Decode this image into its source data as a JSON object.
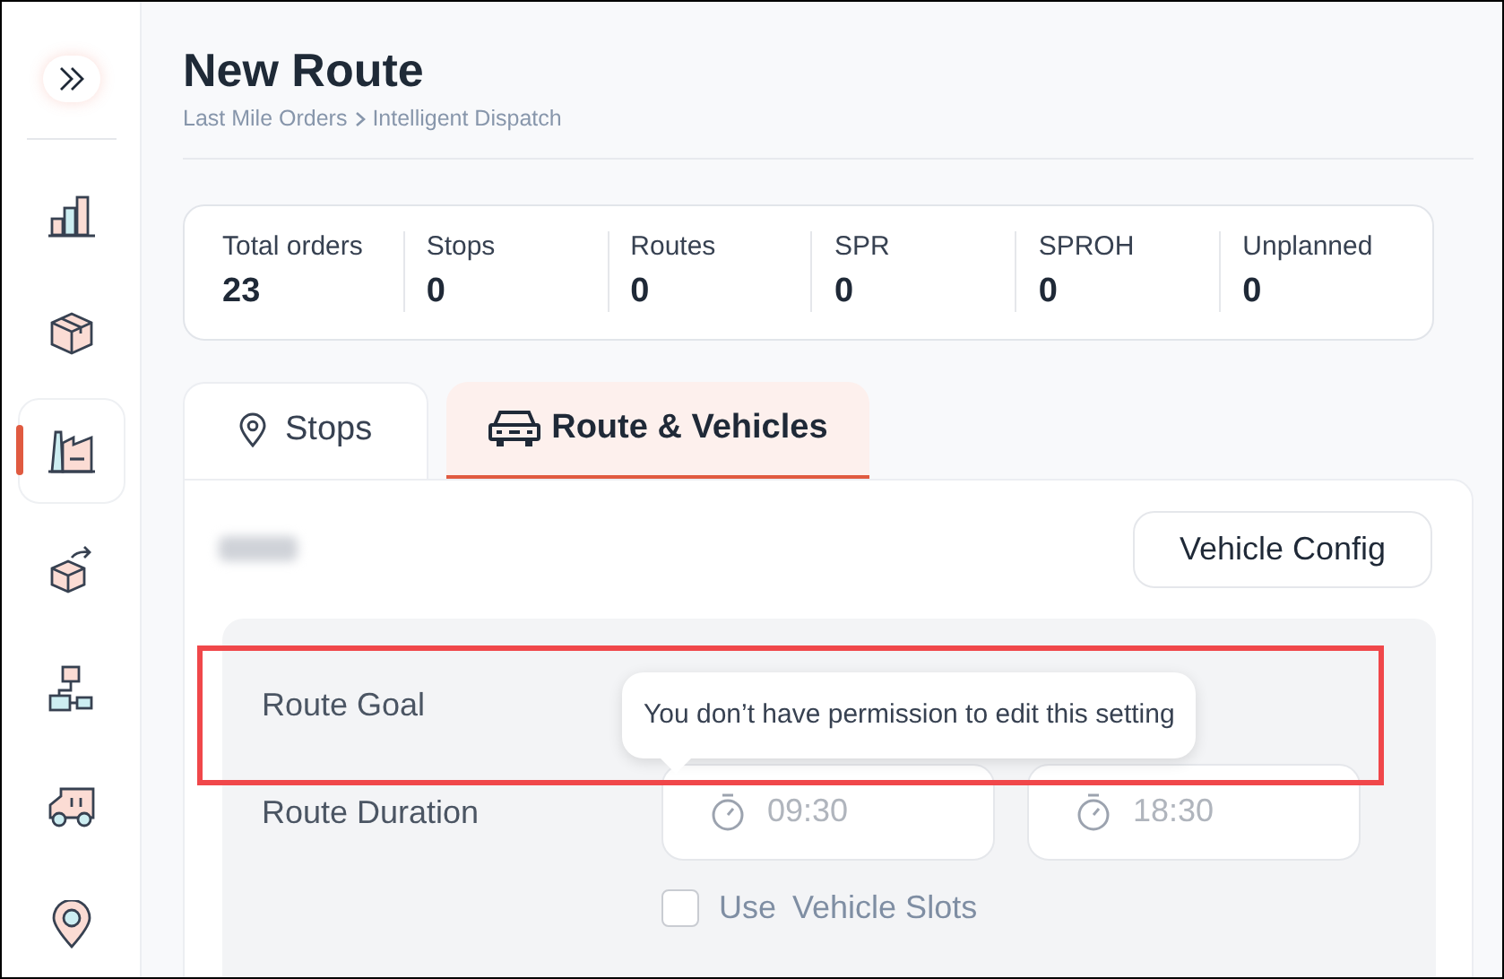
{
  "sidebar": {
    "items": [
      {
        "kind": "chart",
        "selected": false
      },
      {
        "kind": "box",
        "selected": false
      },
      {
        "kind": "dispatch",
        "selected": true
      },
      {
        "kind": "transfer",
        "selected": false
      },
      {
        "kind": "hierarchy",
        "selected": false
      },
      {
        "kind": "truck",
        "selected": false
      },
      {
        "kind": "pin",
        "selected": false
      }
    ]
  },
  "page": {
    "title": "New Route",
    "breadcrumb": [
      "Last Mile Orders",
      "Intelligent Dispatch"
    ]
  },
  "stats": [
    {
      "label": "Total orders",
      "value": "23"
    },
    {
      "label": "Stops",
      "value": "0"
    },
    {
      "label": "Routes",
      "value": "0"
    },
    {
      "label": "SPR",
      "value": "0"
    },
    {
      "label": "SPROH",
      "value": "0"
    },
    {
      "label": "Unplanned",
      "value": "0"
    }
  ],
  "tabs": [
    {
      "label": "Stops",
      "kind": "pin",
      "selected": false
    },
    {
      "label": "Route & Vehicles",
      "kind": "car",
      "selected": true
    }
  ],
  "panel": {
    "vehicle_config_button": "Vehicle Config",
    "route_goal": {
      "label": "Route Goal",
      "tooltip": "You don’t have permission to edit this setting"
    },
    "route_duration": {
      "label": "Route Duration",
      "start": "09:30",
      "end": "18:30"
    },
    "vehicle_slots": {
      "prefix": "Use",
      "link": "Vehicle Slots",
      "checked": false
    }
  }
}
